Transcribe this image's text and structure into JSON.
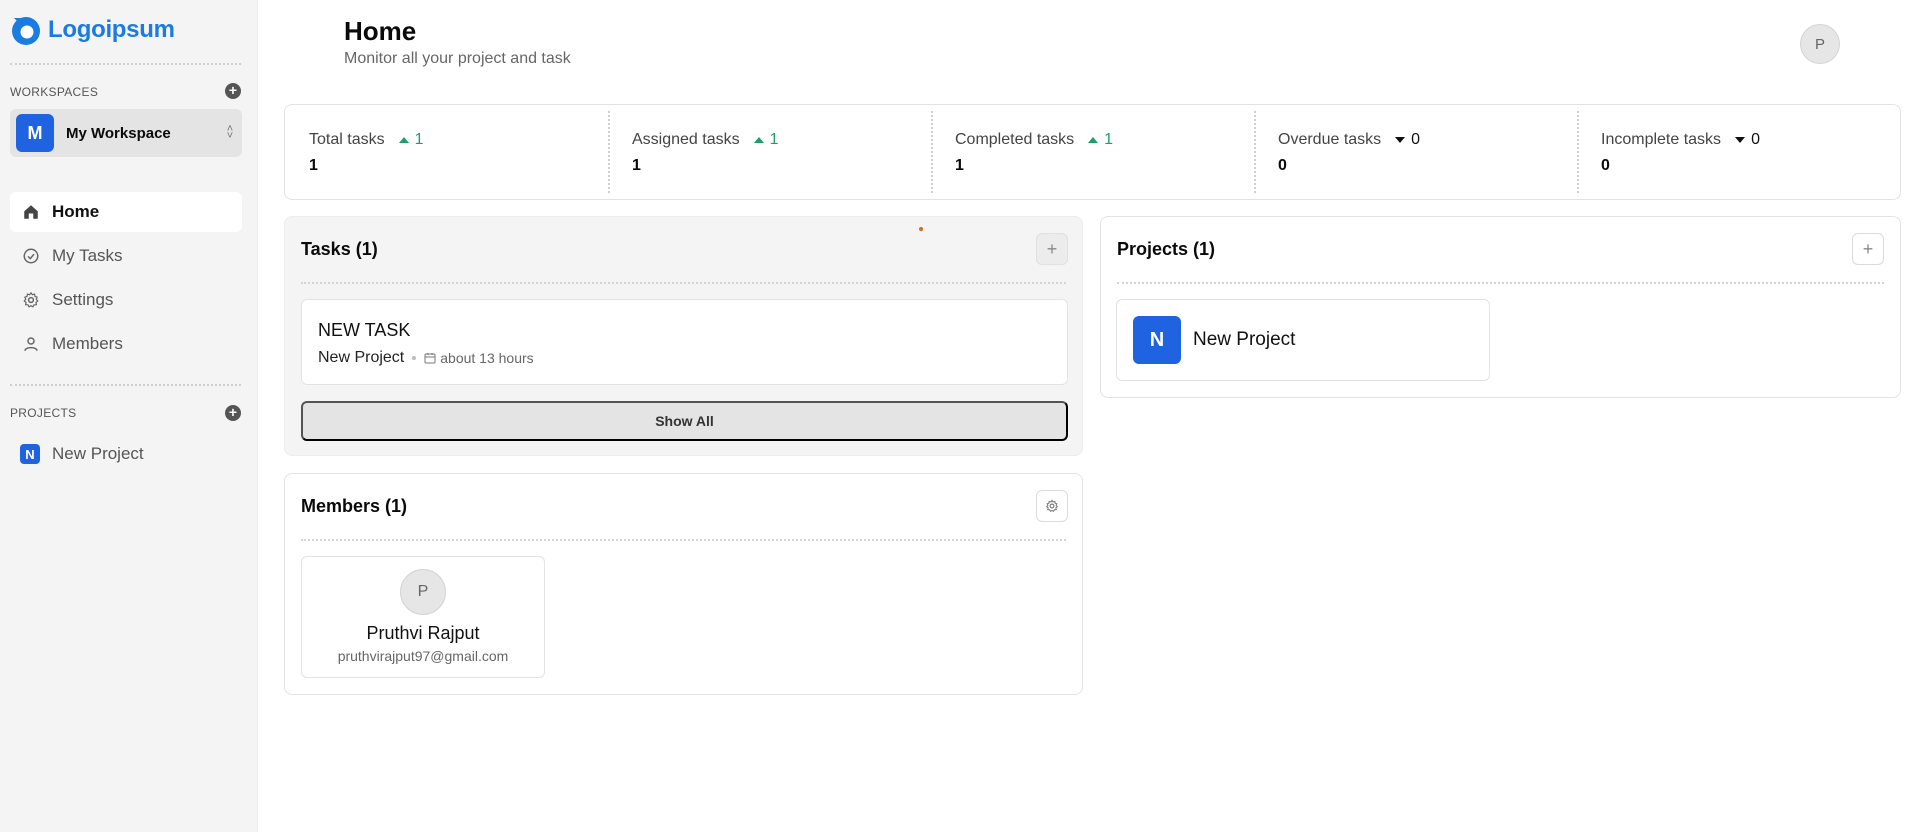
{
  "brand": {
    "name": "Logoipsum",
    "color": "#1a7be0"
  },
  "sidebar": {
    "workspaces_label": "WORKSPACES",
    "workspace": {
      "initial": "M",
      "name": "My Workspace"
    },
    "nav": [
      {
        "label": "Home",
        "icon": "home-icon",
        "active": true
      },
      {
        "label": "My Tasks",
        "icon": "check-circle-icon",
        "active": false
      },
      {
        "label": "Settings",
        "icon": "gear-icon",
        "active": false
      },
      {
        "label": "Members",
        "icon": "user-icon",
        "active": false
      }
    ],
    "projects_label": "PROJECTS",
    "projects": [
      {
        "initial": "N",
        "name": "New Project"
      }
    ]
  },
  "header": {
    "title": "Home",
    "subtitle": "Monitor all your project and task",
    "avatar_initial": "P"
  },
  "stats": [
    {
      "label": "Total tasks",
      "trend": "up",
      "change": "1",
      "value": "1"
    },
    {
      "label": "Assigned tasks",
      "trend": "up",
      "change": "1",
      "value": "1"
    },
    {
      "label": "Completed tasks",
      "trend": "up",
      "change": "1",
      "value": "1"
    },
    {
      "label": "Overdue tasks",
      "trend": "down",
      "change": "0",
      "value": "0"
    },
    {
      "label": "Incomplete tasks",
      "trend": "down",
      "change": "0",
      "value": "0"
    }
  ],
  "tasks_panel": {
    "title": "Tasks (1)",
    "add_icon": "plus-icon",
    "items": [
      {
        "name": "NEW TASK",
        "project": "New Project",
        "due": "about 13 hours"
      }
    ],
    "show_all_label": "Show All"
  },
  "members_panel": {
    "title": "Members (1)",
    "settings_icon": "gear-icon",
    "items": [
      {
        "initial": "P",
        "name": "Pruthvi Rajput",
        "email": "pruthvirajput97@gmail.com"
      }
    ]
  },
  "projects_panel": {
    "title": "Projects (1)",
    "add_icon": "plus-icon",
    "items": [
      {
        "initial": "N",
        "name": "New Project"
      }
    ]
  },
  "colors": {
    "accent": "#1f63e0",
    "trend_up": "#1aa168",
    "sidebar_bg": "#f4f4f4"
  }
}
